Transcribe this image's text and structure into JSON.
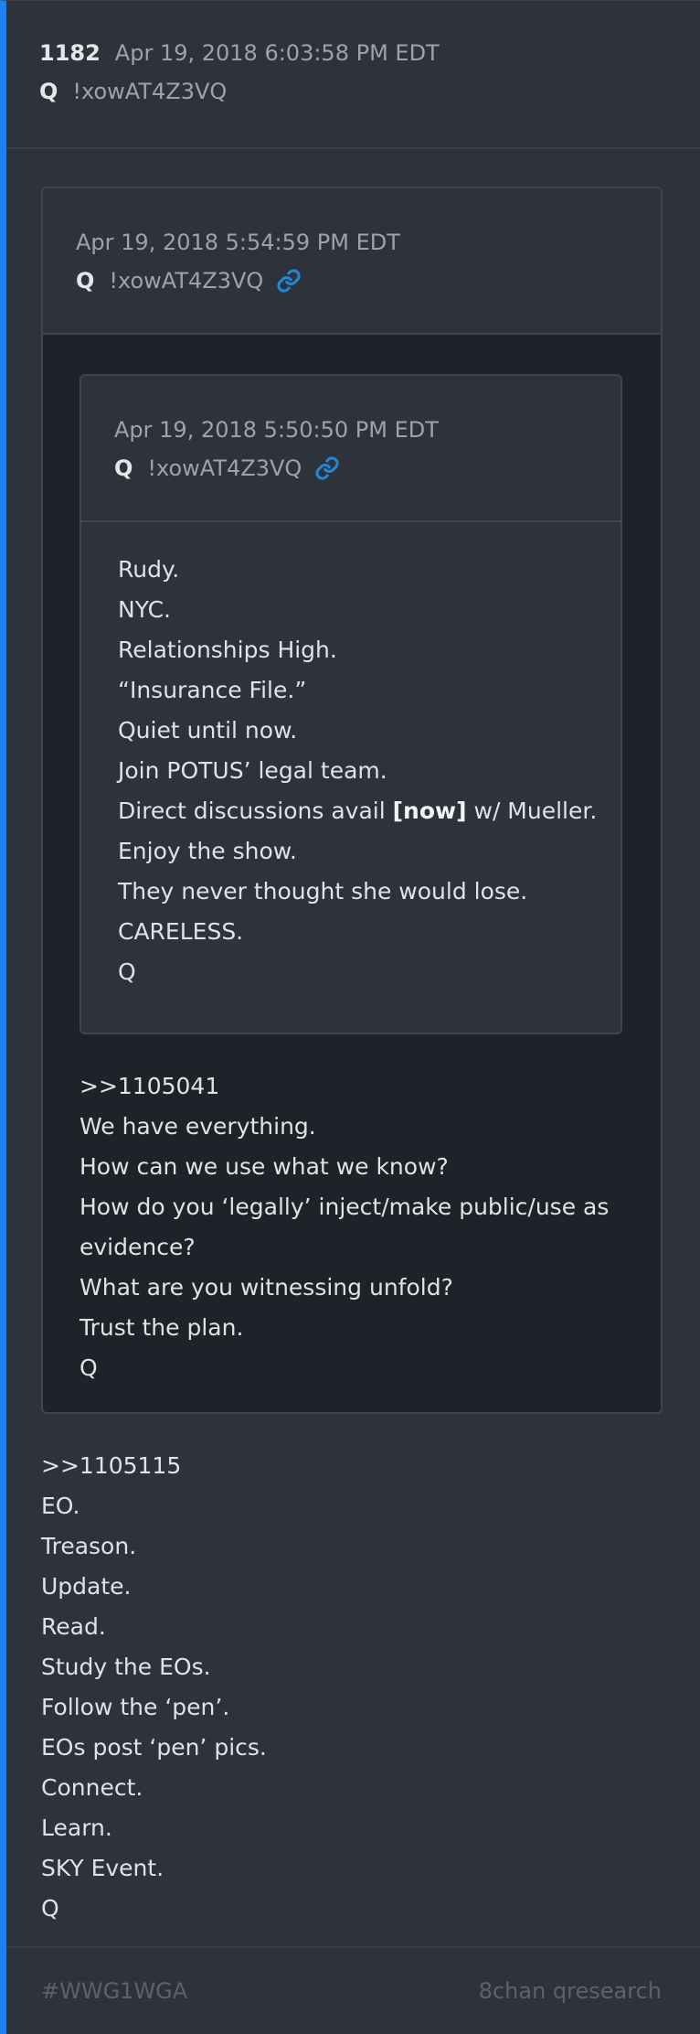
{
  "post": {
    "number": "1182",
    "date": "Apr 19, 2018 6:03:58 PM EDT",
    "author": "Q",
    "tripcode": "!xowAT4Z3VQ"
  },
  "quote_outer": {
    "date": "Apr 19, 2018 5:54:59 PM EDT",
    "author": "Q",
    "tripcode": "!xowAT4Z3VQ",
    "link_icon": "link-icon",
    "lines": [
      ">>1105041",
      "We have everything.",
      "How can we use what we know?",
      "How do you ‘legally’ inject/make public/use as",
      "evidence?",
      "What are you witnessing unfold?",
      "Trust the plan.",
      "Q"
    ]
  },
  "quote_inner": {
    "date": "Apr 19, 2018 5:50:50 PM EDT",
    "author": "Q",
    "tripcode": "!xowAT4Z3VQ",
    "link_icon": "link-icon",
    "lines": [
      "Rudy.",
      "NYC.",
      "Relationships High.",
      "“Insurance File.”",
      "Quiet until now.",
      "Join POTUS’ legal team.",
      "Direct discussions avail",
      "Enjoy the show.",
      "They never thought she would lose.",
      "CARELESS.",
      "Q"
    ],
    "direct_line_bold": "[now]",
    "direct_line_tail": " w/ Mueller."
  },
  "body": {
    "lines": [
      ">>1105115",
      "EO.",
      "Treason.",
      "Update.",
      "Read.",
      "Study the EOs.",
      "Follow the ‘pen’.",
      "EOs post ‘pen’ pics.",
      "Connect.",
      "Learn.",
      "SKY Event.",
      "Q"
    ]
  },
  "footer": {
    "hashtag": "#WWG1WGA",
    "source": "8chan qresearch"
  },
  "colors": {
    "accent_bar": "#1d7ff2",
    "link": "#1e88d6",
    "background": "#2e323a"
  }
}
